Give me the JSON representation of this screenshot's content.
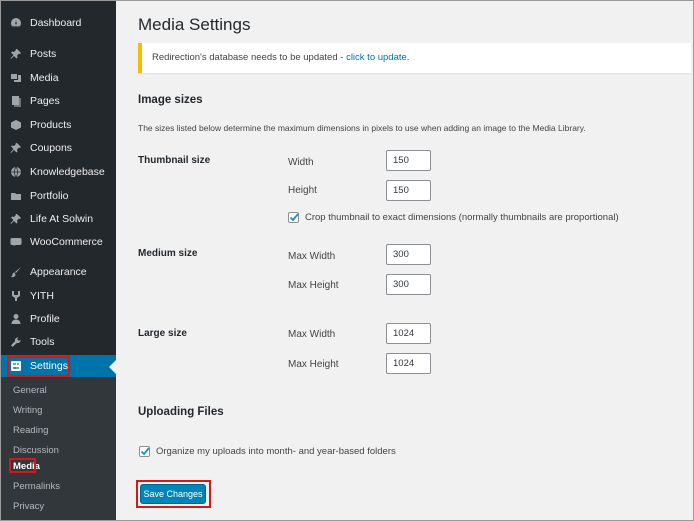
{
  "sidebar": {
    "items": [
      {
        "label": "Dashboard",
        "icon": "dashboard-icon"
      },
      {
        "label": "Posts",
        "icon": "pin-icon"
      },
      {
        "label": "Media",
        "icon": "media-icon"
      },
      {
        "label": "Pages",
        "icon": "pages-icon"
      },
      {
        "label": "Products",
        "icon": "products-icon"
      },
      {
        "label": "Coupons",
        "icon": "pin-icon"
      },
      {
        "label": "Knowledgebase",
        "icon": "globe-icon"
      },
      {
        "label": "Portfolio",
        "icon": "folder-icon"
      },
      {
        "label": "Life At Solwin",
        "icon": "pin-icon"
      },
      {
        "label": "WooCommerce",
        "icon": "woocommerce-icon"
      },
      {
        "label": "Appearance",
        "icon": "brush-icon"
      },
      {
        "label": "YITH",
        "icon": "yith-icon"
      },
      {
        "label": "Profile",
        "icon": "user-icon"
      },
      {
        "label": "Tools",
        "icon": "wrench-icon"
      },
      {
        "label": "Settings",
        "icon": "settings-icon"
      }
    ],
    "submenu": [
      "General",
      "Writing",
      "Reading",
      "Discussion",
      "Media",
      "Permalinks",
      "Privacy"
    ]
  },
  "page": {
    "title": "Media Settings"
  },
  "notice": {
    "text": "Redirection's database needs to be updated - ",
    "link": "click to update",
    "suffix": "."
  },
  "image_sizes": {
    "heading": "Image sizes",
    "description": "The sizes listed below determine the maximum dimensions in pixels to use when adding an image to the Media Library.",
    "thumbnail": {
      "label": "Thumbnail size",
      "width_label": "Width",
      "width": "150",
      "height_label": "Height",
      "height": "150",
      "crop_label": "Crop thumbnail to exact dimensions (normally thumbnails are proportional)",
      "crop_checked": true
    },
    "medium": {
      "label": "Medium size",
      "max_width_label": "Max Width",
      "max_width": "300",
      "max_height_label": "Max Height",
      "max_height": "300"
    },
    "large": {
      "label": "Large size",
      "max_width_label": "Max Width",
      "max_width": "1024",
      "max_height_label": "Max Height",
      "max_height": "1024"
    }
  },
  "uploading": {
    "heading": "Uploading Files",
    "organize_label": "Organize my uploads into month- and year-based folders",
    "organize_checked": true
  },
  "save_label": "Save Changes",
  "colors": {
    "sidebar_bg": "#23282d",
    "active_bg": "#0073aa",
    "highlight": "#d01a1a",
    "notice_border": "#ffb900",
    "button_bg": "#0085ba"
  }
}
